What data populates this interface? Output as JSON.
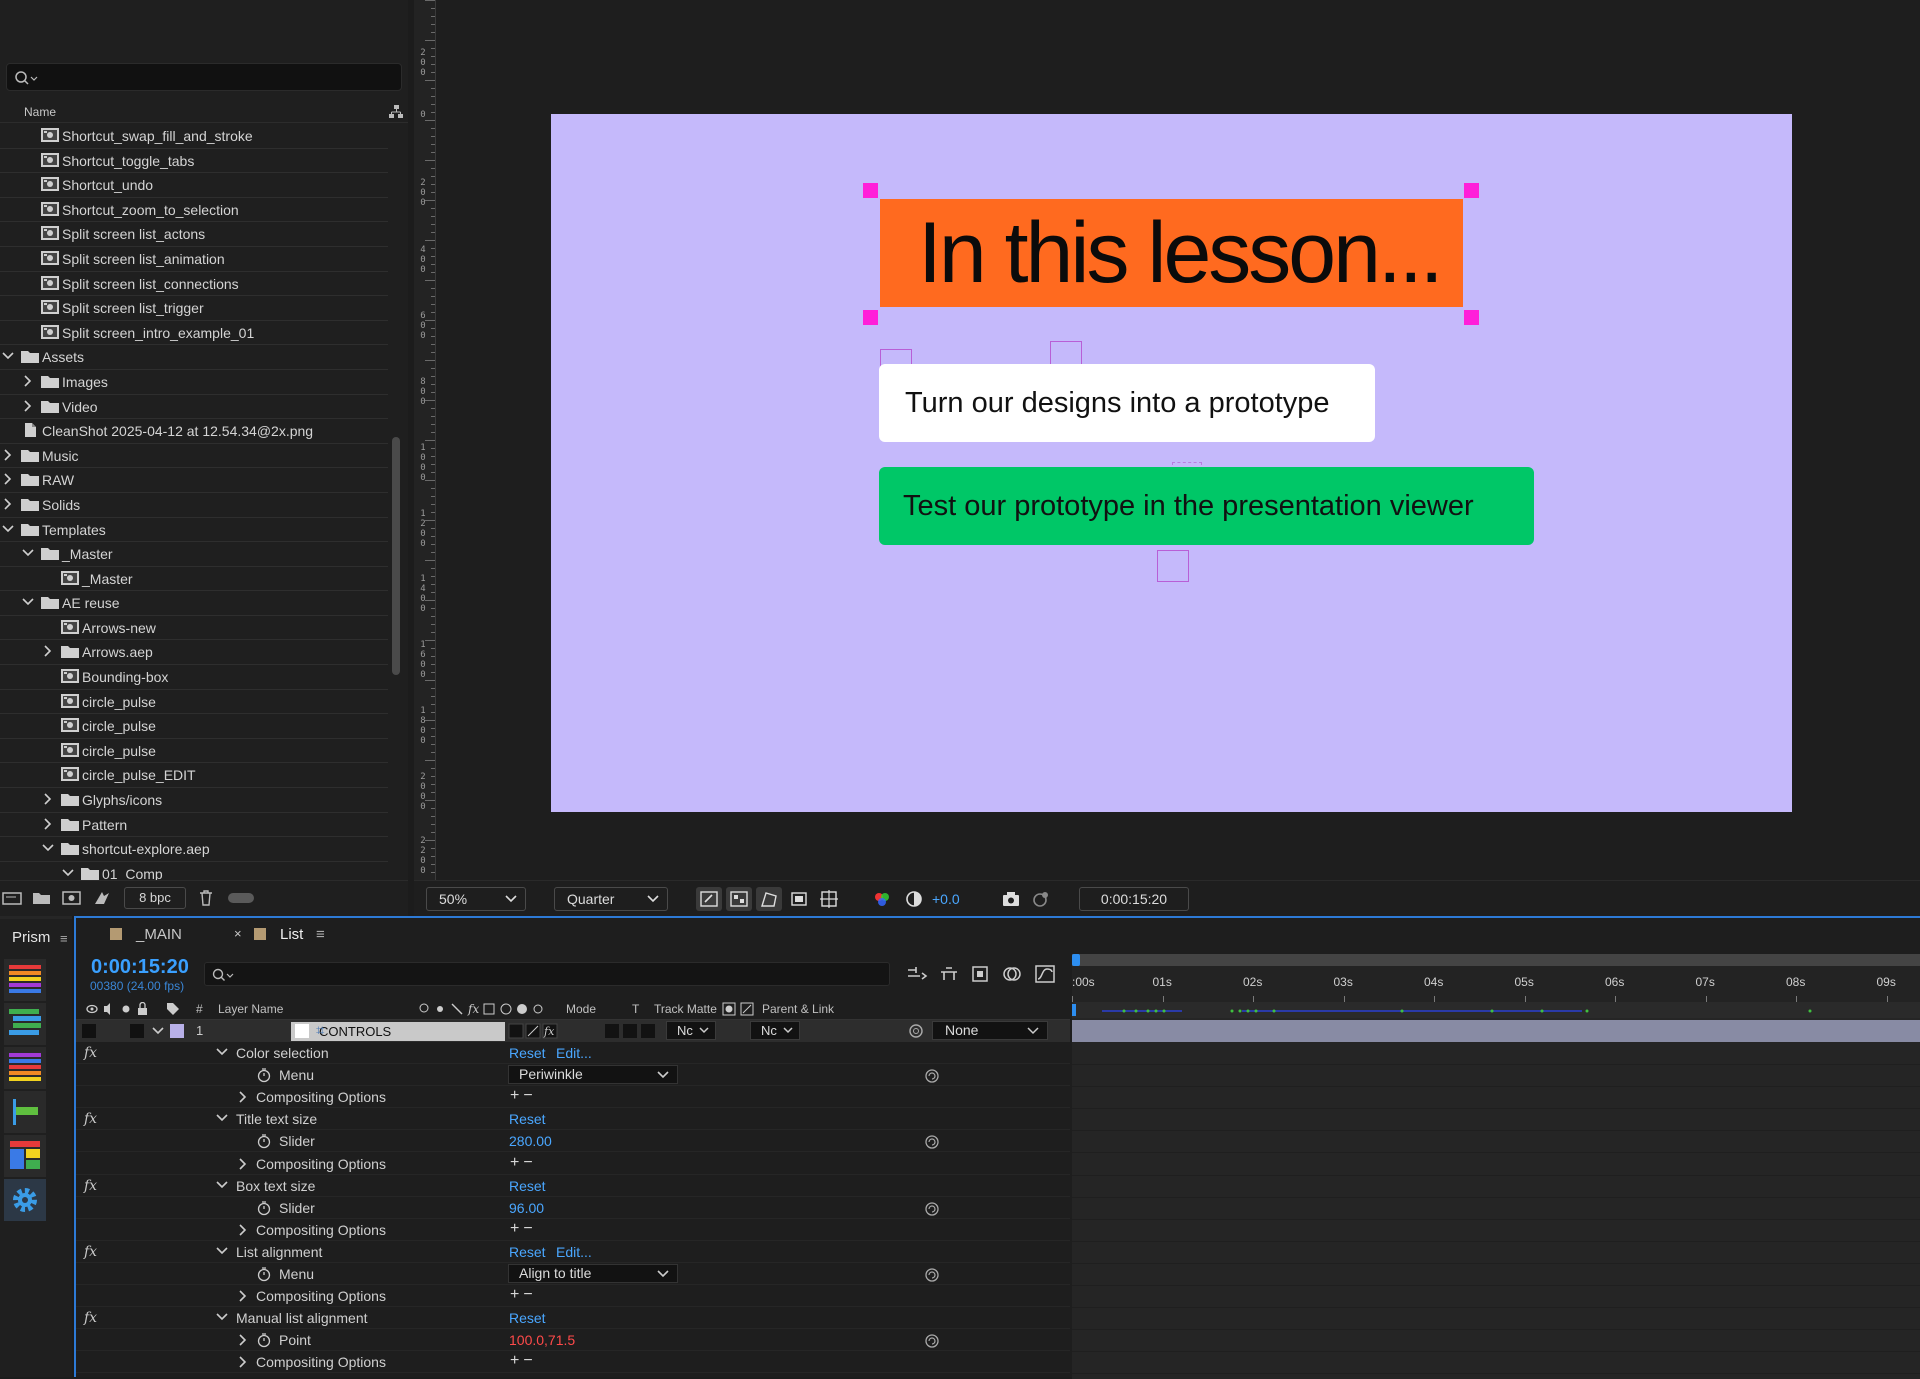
{
  "project": {
    "name_header": "Name",
    "items": [
      {
        "label": "Shortcut_swap_fill_and_stroke",
        "kind": "comp",
        "indent": 1
      },
      {
        "label": "Shortcut_toggle_tabs",
        "kind": "comp",
        "indent": 1
      },
      {
        "label": "Shortcut_undo",
        "kind": "comp",
        "indent": 1
      },
      {
        "label": "Shortcut_zoom_to_selection",
        "kind": "comp",
        "indent": 1
      },
      {
        "label": "Split screen list_actons",
        "kind": "comp",
        "indent": 1
      },
      {
        "label": "Split screen list_animation",
        "kind": "comp",
        "indent": 1
      },
      {
        "label": "Split screen list_connections",
        "kind": "comp",
        "indent": 1
      },
      {
        "label": "Split screen list_trigger",
        "kind": "comp",
        "indent": 1
      },
      {
        "label": "Split screen_intro_example_01",
        "kind": "comp",
        "indent": 1
      },
      {
        "label": "Assets",
        "kind": "folder-open",
        "indent": 0
      },
      {
        "label": "Images",
        "kind": "folder",
        "indent": 1
      },
      {
        "label": "Video",
        "kind": "folder",
        "indent": 1
      },
      {
        "label": "CleanShot 2025-04-12 at 12.54.34@2x.png",
        "kind": "file",
        "indent": 0
      },
      {
        "label": "Music",
        "kind": "folder",
        "indent": 0
      },
      {
        "label": "RAW",
        "kind": "folder",
        "indent": 0
      },
      {
        "label": "Solids",
        "kind": "folder",
        "indent": 0
      },
      {
        "label": "Templates",
        "kind": "folder-open",
        "indent": 0
      },
      {
        "label": "_Master",
        "kind": "folder-open",
        "indent": 1
      },
      {
        "label": "_Master",
        "kind": "comp",
        "indent": 2
      },
      {
        "label": "AE reuse",
        "kind": "folder-open",
        "indent": 1
      },
      {
        "label": "Arrows-new",
        "kind": "comp",
        "indent": 2
      },
      {
        "label": "Arrows.aep",
        "kind": "folder",
        "indent": 2
      },
      {
        "label": "Bounding-box",
        "kind": "comp",
        "indent": 2
      },
      {
        "label": "circle_pulse",
        "kind": "comp",
        "indent": 2
      },
      {
        "label": "circle_pulse",
        "kind": "comp",
        "indent": 2
      },
      {
        "label": "circle_pulse",
        "kind": "comp",
        "indent": 2
      },
      {
        "label": "circle_pulse_EDIT",
        "kind": "comp",
        "indent": 2
      },
      {
        "label": "Glyphs/icons",
        "kind": "folder",
        "indent": 2
      },
      {
        "label": "Pattern",
        "kind": "folder",
        "indent": 2
      },
      {
        "label": "shortcut-explore.aep",
        "kind": "folder-open",
        "indent": 2
      },
      {
        "label": "01_Comp",
        "kind": "folder-open",
        "indent": 3
      }
    ],
    "bpc": "8 bpc"
  },
  "ruler": {
    "labels": [
      "200",
      "0",
      "200",
      "400",
      "600",
      "800",
      "1000",
      "1200",
      "1400",
      "1600",
      "1800",
      "2000",
      "2200"
    ]
  },
  "composition": {
    "title": "In this lesson...",
    "item1": "Turn our designs into a prototype",
    "item2": "Test our prototype in the presentation viewer",
    "bg_color": "#c5b9fb",
    "title_bg": "#ff6a1f",
    "item2_bg": "#00c767"
  },
  "viewer_toolbar": {
    "zoom": "50%",
    "resolution": "Quarter",
    "exposure": "+0.0",
    "timecode": "0:00:15:20"
  },
  "prism": {
    "tab": "Prism"
  },
  "timeline": {
    "tabs": [
      {
        "label": "_MAIN"
      },
      {
        "label": "List"
      }
    ],
    "timecode": "0:00:15:20",
    "frames": "00380 (24.00 fps)",
    "columns": {
      "num": "#",
      "layer_name": "Layer Name",
      "mode": "Mode",
      "t": "T",
      "track_matte": "Track Matte",
      "parent": "Parent & Link"
    },
    "layer": {
      "index": "1",
      "name": "CONTROLS",
      "mode": "Nc",
      "matte": "Nc",
      "parent": "None"
    },
    "effects": [
      {
        "name": "Color selection",
        "links": [
          "Reset",
          "Edit..."
        ],
        "prop": "Menu",
        "value": "Periwinkle",
        "value_kind": "dropdown"
      },
      {
        "name": "Title text size",
        "links": [
          "Reset"
        ],
        "prop": "Slider",
        "value": "280.00",
        "value_kind": "number"
      },
      {
        "name": "Box text size",
        "links": [
          "Reset"
        ],
        "prop": "Slider",
        "value": "96.00",
        "value_kind": "number"
      },
      {
        "name": "List alignment",
        "links": [
          "Reset",
          "Edit..."
        ],
        "prop": "Menu",
        "value": "Align to title",
        "value_kind": "dropdown"
      },
      {
        "name": "Manual list alignment",
        "links": [
          "Reset"
        ],
        "prop": "Point",
        "value": "100.0,71.5",
        "value_kind": "point"
      }
    ],
    "compositing": "Compositing Options",
    "time_labels": [
      ":00s",
      "01s",
      "02s",
      "03s",
      "04s",
      "05s",
      "06s",
      "07s",
      "08s",
      "09s"
    ]
  }
}
